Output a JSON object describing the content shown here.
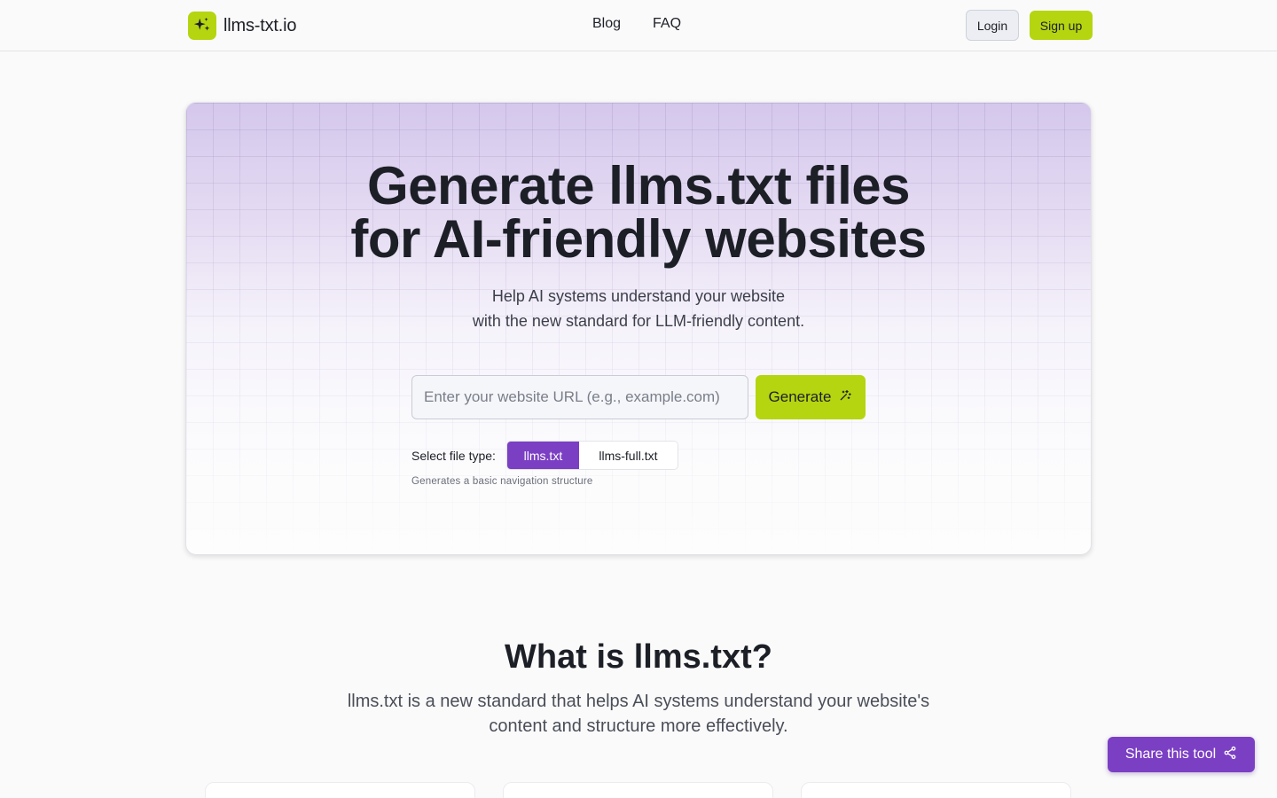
{
  "header": {
    "logo_text": "llms-txt.io",
    "nav": [
      "Blog",
      "FAQ"
    ],
    "login_label": "Login",
    "signup_label": "Sign up"
  },
  "hero": {
    "title_line1": "Generate llms.txt files",
    "title_line2": "for AI-friendly websites",
    "subtitle_line1": "Help AI systems understand your website",
    "subtitle_line2": "with the new standard for LLM-friendly content.",
    "url_placeholder": "Enter your website URL (e.g., example.com)",
    "url_value": "",
    "generate_label": "Generate",
    "filetype_label": "Select file type:",
    "filetype_options": [
      "llms.txt",
      "llms-full.txt"
    ],
    "filetype_selected": "llms.txt",
    "filetype_help": "Generates a basic navigation structure"
  },
  "what_is": {
    "title": "What is llms.txt?",
    "desc_line1": "llms.txt is a new standard that helps AI systems understand your website's",
    "desc_line2": "content and structure more effectively."
  },
  "share": {
    "label": "Share this tool"
  },
  "colors": {
    "accent_lime": "#b5d510",
    "accent_purple": "#7b3fc4",
    "text_dark": "#1c1f26"
  },
  "icons": {
    "logo": "sparkles-icon",
    "generate": "magic-wand-icon",
    "share": "share-icon"
  }
}
